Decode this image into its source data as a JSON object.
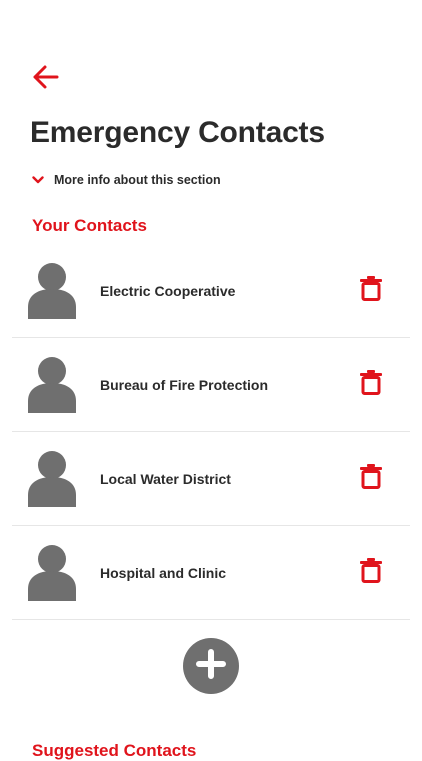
{
  "header": {
    "title": "Emergency Contacts",
    "back_icon": "arrow-left-icon"
  },
  "info_toggle": {
    "label": "More info about this section",
    "icon": "chevron-down-icon"
  },
  "your_contacts": {
    "title": "Your Contacts",
    "items": [
      {
        "name": "Electric Cooperative"
      },
      {
        "name": "Bureau of Fire Protection"
      },
      {
        "name": "Local Water District"
      },
      {
        "name": "Hospital and Clinic"
      }
    ]
  },
  "suggested_contacts": {
    "title": "Suggested Contacts"
  },
  "colors": {
    "accent": "#e0141c",
    "icon_gray": "#6f6f6f",
    "text": "#2b2b2b"
  }
}
